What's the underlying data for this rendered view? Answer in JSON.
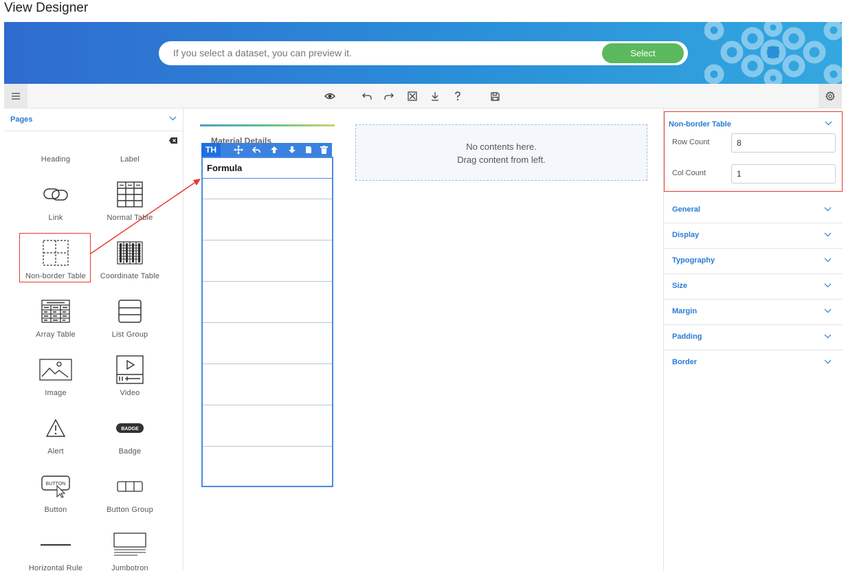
{
  "app": {
    "title": "View Designer"
  },
  "banner": {
    "search_placeholder": "If you select a dataset, you can preview it.",
    "select_label": "Select"
  },
  "toolbar": {
    "icons": [
      "menu-icon",
      "eye-icon",
      "undo-icon",
      "redo-icon",
      "fullscreen-icon",
      "download-icon",
      "help-icon",
      "save-icon",
      "settings-icon"
    ]
  },
  "left_panel": {
    "section_label": "Pages",
    "components": [
      {
        "name": "Heading",
        "icon": "heading-icon"
      },
      {
        "name": "Label",
        "icon": "label-icon"
      },
      {
        "name": "Link",
        "icon": "link-icon"
      },
      {
        "name": "Normal Table",
        "icon": "normal-table-icon"
      },
      {
        "name": "Non-border Table",
        "icon": "non-border-table-icon"
      },
      {
        "name": "Coordinate Table",
        "icon": "coordinate-table-icon"
      },
      {
        "name": "Array Table",
        "icon": "array-table-icon"
      },
      {
        "name": "List Group",
        "icon": "list-group-icon"
      },
      {
        "name": "Image",
        "icon": "image-icon"
      },
      {
        "name": "Video",
        "icon": "video-icon"
      },
      {
        "name": "Alert",
        "icon": "alert-icon"
      },
      {
        "name": "Badge",
        "icon": "badge-icon"
      },
      {
        "name": "Button",
        "icon": "button-icon"
      },
      {
        "name": "Button Group",
        "icon": "button-group-icon"
      },
      {
        "name": "Horizontal Rule",
        "icon": "horizontal-rule-icon"
      },
      {
        "name": "Jumbotron",
        "icon": "jumbotron-icon"
      }
    ],
    "badge_icon_text": "BADGE",
    "button_icon_text": "BUTTON"
  },
  "canvas": {
    "card_title": "Material Details",
    "cell_toolbar_tag": "TH",
    "table_header": "Formula",
    "row_count": 8,
    "dropzone_line1": "No contents here.",
    "dropzone_line2": "Drag content from left."
  },
  "right_panel": {
    "selected_component": "Non-border Table",
    "row_count_label": "Row Count",
    "row_count_value": "8",
    "col_count_label": "Col Count",
    "col_count_value": "1",
    "sections": [
      "General",
      "Display",
      "Typography",
      "Size",
      "Margin",
      "Padding",
      "Border"
    ]
  },
  "colors": {
    "accent": "#2a7ad5",
    "highlight": "#e53a2e",
    "select_button": "#5cb85c",
    "table_border": "#4a8be0"
  }
}
